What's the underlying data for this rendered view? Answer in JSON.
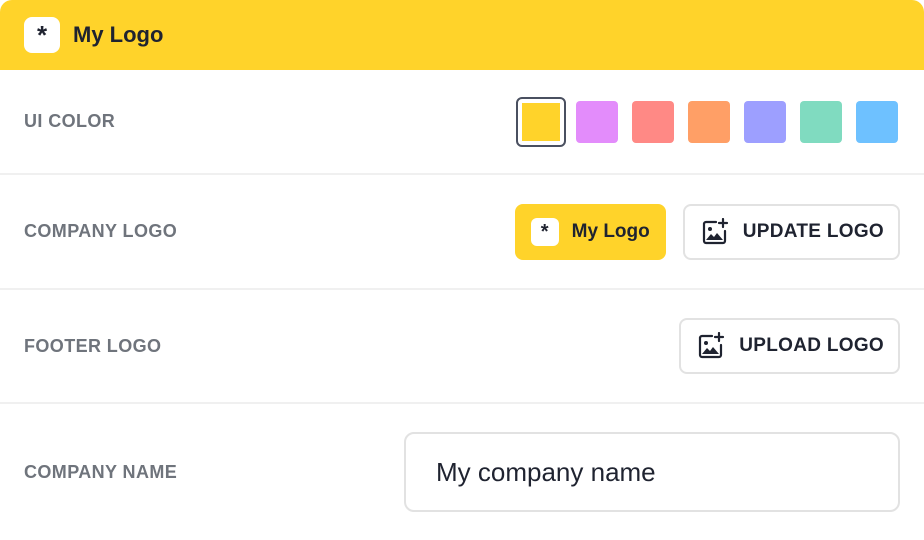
{
  "header": {
    "logo_symbol": "*",
    "title": "My Logo",
    "background": "#ffd32a"
  },
  "ui_color": {
    "label": "UI COLOR",
    "selected": "yellow",
    "swatches": [
      {
        "name": "yellow",
        "color": "#ffd32a"
      },
      {
        "name": "violet",
        "color": "#e38cfb"
      },
      {
        "name": "coral",
        "color": "#ff8985"
      },
      {
        "name": "orange",
        "color": "#ff9f66"
      },
      {
        "name": "periwinkle",
        "color": "#9d9fff"
      },
      {
        "name": "mint",
        "color": "#80dbc0"
      },
      {
        "name": "sky",
        "color": "#6ec1ff"
      }
    ]
  },
  "company_logo": {
    "label": "COMPANY LOGO",
    "preview_symbol": "*",
    "preview_text": "My Logo",
    "button_label": "UPDATE LOGO",
    "button_icon": "add-image-icon"
  },
  "footer_logo": {
    "label": "FOOTER LOGO",
    "button_label": "UPLOAD LOGO",
    "button_icon": "add-image-icon"
  },
  "company_name": {
    "label": "COMPANY NAME",
    "value": "My company name"
  }
}
